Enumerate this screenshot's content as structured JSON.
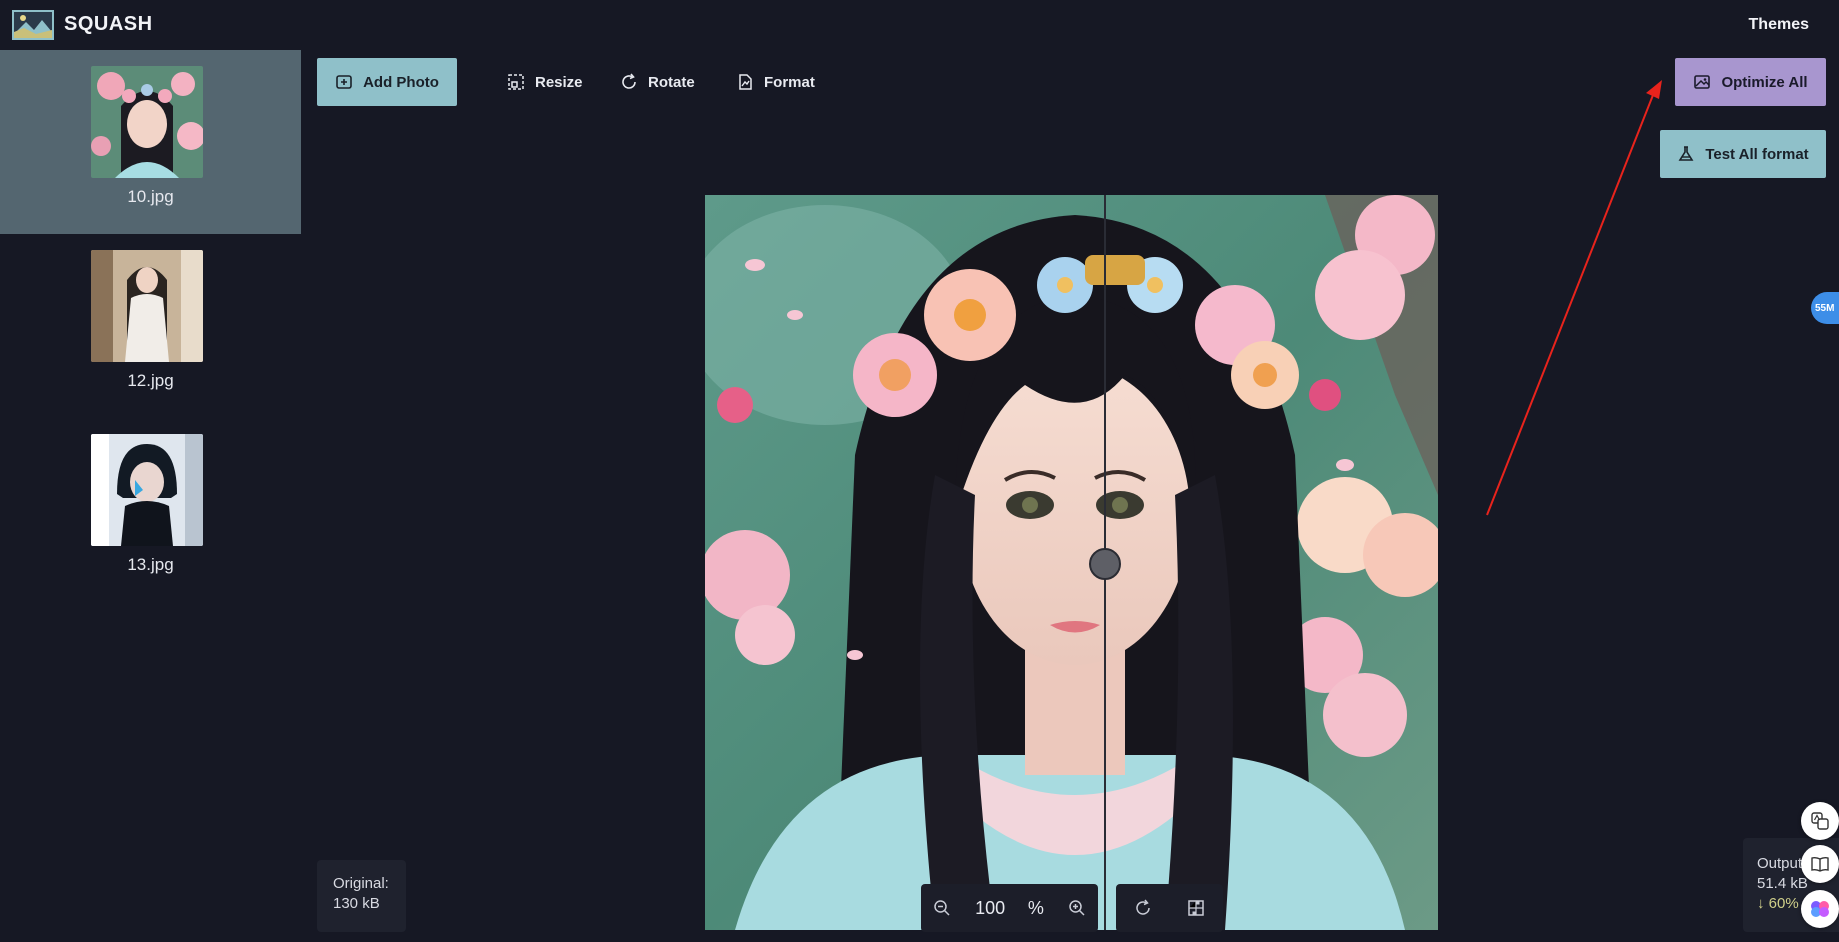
{
  "app": {
    "title": "SQUASH",
    "themes_label": "Themes"
  },
  "sidebar": {
    "items": [
      {
        "label": "10.jpg",
        "active": true
      },
      {
        "label": "12.jpg",
        "active": false
      },
      {
        "label": "13.jpg",
        "active": false
      }
    ]
  },
  "toolbar": {
    "add_photo": "Add Photo",
    "resize": "Resize",
    "rotate": "Rotate",
    "format": "Format",
    "optimize_all": "Optimize All",
    "test_all_format": "Test All format"
  },
  "viewer": {
    "zoom_value": "100",
    "zoom_unit": "%"
  },
  "sizes": {
    "original_label": "Original:",
    "original_value": "130 kB",
    "output_label": "Output",
    "output_value": "51.4 kB",
    "saving": "↓ 60%"
  },
  "floating": {
    "badge": "55M"
  },
  "colors": {
    "background": "#161824",
    "accent_teal": "#8fc0c9",
    "accent_purple": "#a896cf",
    "active_item": "#546670",
    "annotation_arrow": "#e8231c"
  },
  "icons": [
    "add-photo-icon",
    "resize-icon",
    "rotate-icon",
    "format-icon",
    "optimize-icon",
    "flask-icon",
    "zoom-out-icon",
    "zoom-in-icon",
    "rotate-view-icon",
    "compare-icon",
    "translate-icon",
    "book-icon",
    "brain-icon"
  ]
}
